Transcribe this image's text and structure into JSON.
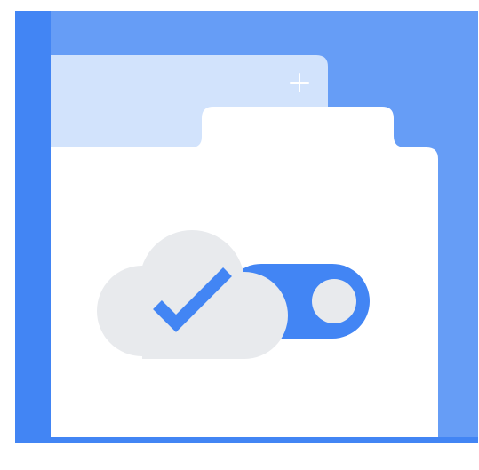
{
  "illustration": {
    "subject": "folder-cloud-sync-toggle",
    "colors": {
      "frame_blue": "#4285F4",
      "panel_blue": "#669DF6",
      "back_tab_blue": "#D2E3FC",
      "folder_white": "#FFFFFF",
      "cloud_grey": "#E8EAED",
      "check_blue": "#4285F4",
      "toggle_blue": "#4285F4",
      "knob_grey": "#E8EAED",
      "plus_white": "#FFFFFF"
    },
    "toggle": {
      "state": "on"
    },
    "icons": [
      "folder-icon",
      "cloud-icon",
      "checkmark-icon",
      "toggle-switch-icon",
      "plus-icon"
    ]
  }
}
